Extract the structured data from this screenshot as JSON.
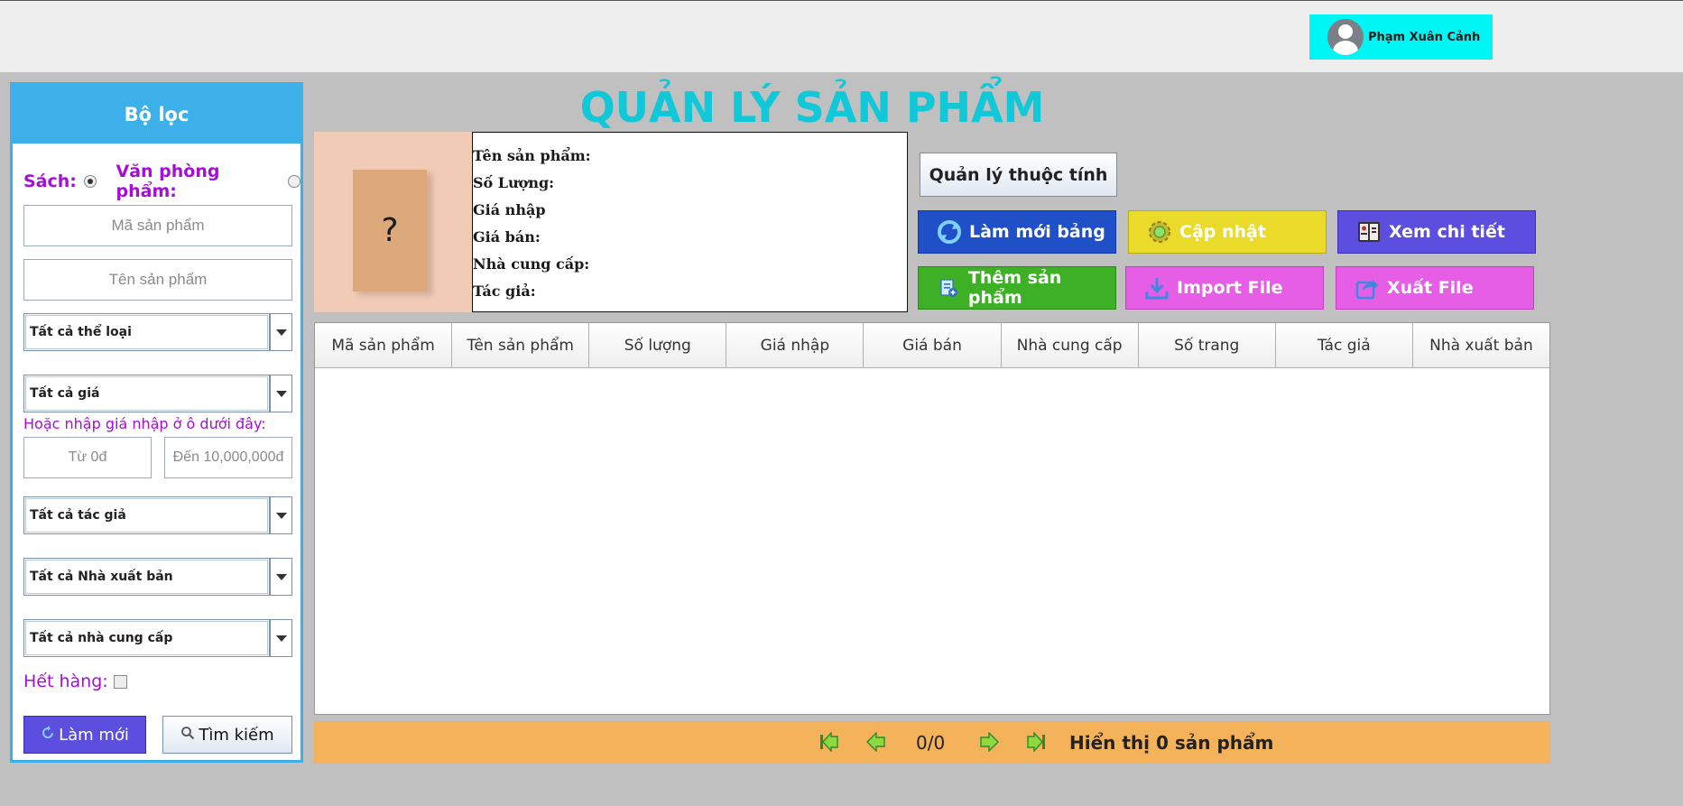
{
  "header": {
    "user_name": "Phạm Xuân Cảnh",
    "user_icon": "user-avatar-icon"
  },
  "sidebar": {
    "title": "Bộ lọc",
    "radio_book_label": "Sách:",
    "radio_stationery_label": "Văn phòng phẩm:",
    "radio_selected": "Sách",
    "product_code_placeholder": "Mã sản phẩm",
    "product_name_placeholder": "Tên sản phẩm",
    "category_select": "Tất cả thể loại",
    "price_select": "Tất cả giá",
    "price_hint": "Hoặc nhập giá nhập ở ô dưới đây:",
    "price_from_placeholder": "Từ 0đ",
    "price_to_placeholder": "Đến 10,000,000đ",
    "author_select": "Tất cả tác giả",
    "publisher_select": "Tất cả Nhà xuất bản",
    "supplier_select": "Tất cả nhà cung cấp",
    "out_of_stock_label": "Hết hàng:",
    "reset_button": "Làm mới",
    "search_button": "Tìm kiếm"
  },
  "main": {
    "title": "QUẢN LÝ SẢN PHẨM",
    "image_placeholder": "?",
    "info_labels": [
      "Tên sản phẩm:",
      "Số Lượng:",
      "Giá nhập",
      "Giá bán:",
      "Nhà cung cấp:",
      "Tác giả:"
    ],
    "buttons": {
      "attributes": "Quản lý thuộc tính",
      "refresh_table": "Làm mới bảng",
      "update": "Cập nhật",
      "view_detail": "Xem chi tiết",
      "add_product": "Thêm sản phẩm",
      "import_file": "Import File",
      "export_file": "Xuất File"
    },
    "table": {
      "columns": [
        "Mã sản phẩm",
        "Tên sản phẩm",
        "Số lượng",
        "Giá nhập",
        "Giá bán",
        "Nhà cung cấp",
        "Số trang",
        "Tác giả",
        "Nhà xuất bản"
      ],
      "rows": []
    },
    "pager": {
      "page_text": "0/0",
      "count_text": "Hiển thị 0 sản phẩm"
    }
  },
  "colors": {
    "accent_cyan": "#10c8d8",
    "sidebar_blue": "#3db0ea",
    "purple_text": "#a40ed6",
    "pager_orange": "#f4b25a"
  }
}
